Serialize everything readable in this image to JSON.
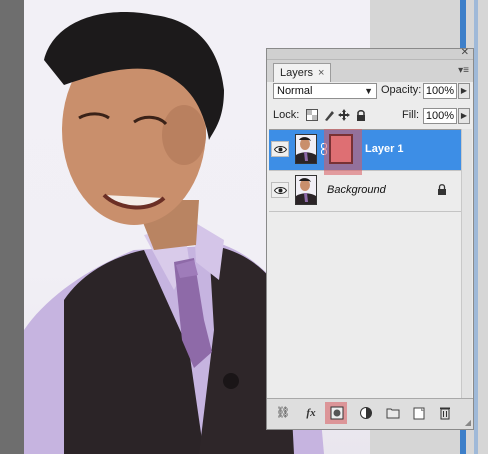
{
  "colors": {
    "selection_blue": "#3d8ee6",
    "mask_fill": "#e28b8d",
    "highlight_red": "#da5a5f",
    "panel_bg": "#ececec"
  },
  "layers_panel": {
    "tab_label": "Layers",
    "tab_close": "×",
    "blend_mode": "Normal",
    "opacity_label": "Opacity:",
    "opacity_value": "100%",
    "lock_label": "Lock:",
    "fill_label": "Fill:",
    "fill_value": "100%",
    "layers": [
      {
        "name": "Layer 1",
        "selected": true,
        "has_mask": true
      },
      {
        "name": "Background",
        "selected": false,
        "locked": true
      }
    ],
    "footer_icons": [
      "link-layers-icon",
      "fx-icon",
      "add-mask-icon",
      "adjustment-layer-icon",
      "group-folder-icon",
      "new-layer-icon",
      "trash-icon"
    ],
    "fx_label": "fx"
  }
}
